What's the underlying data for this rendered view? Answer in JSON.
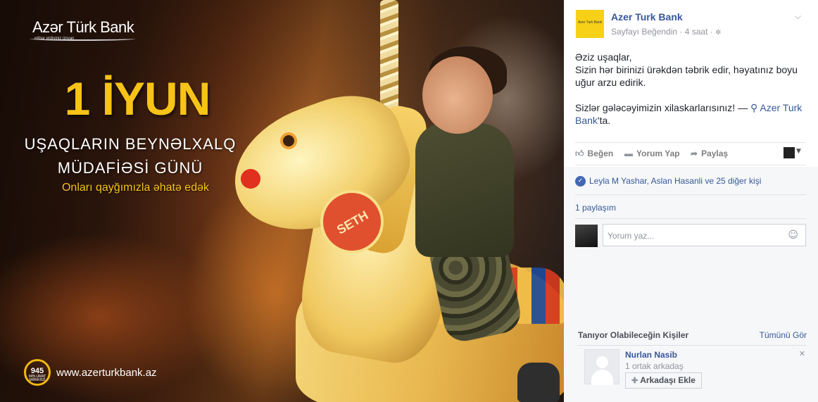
{
  "image": {
    "logo": {
      "name": "Azər Türk Bank",
      "slogan": "etibar etdiyiniz ünvan"
    },
    "headline": "1 İYUN",
    "subtitle_line1": "UŞAQLARIN BEYNƏLXALQ",
    "subtitle_line2": "MÜDAFİƏSİ GÜNÜ",
    "tagline": "Onları qayğımızla əhatə edək",
    "horse_tag": "SETH",
    "badge": {
      "number": "945",
      "text": "MƏLUMAT MƏRKƏZİ"
    },
    "website": "www.azerturkbank.az"
  },
  "post": {
    "page_avatar_text": "Azer Turk Bank",
    "page_name": "Azer Turk Bank",
    "meta": "Sayfayı Beğendin · 4 saat ·",
    "text_line1": "Əziz uşaqlar,",
    "text_line2": "Sizin hər birinizi ürəkdən təbrik edir, həyatınız boyu uğur arzu edirik.",
    "text_line3": "Sizlər gələcəyimizin xilaskarlarısınız! —",
    "location": "Azer Turk Bank",
    "location_suffix": "'ta."
  },
  "actions": {
    "like": "Beğen",
    "comment": "Yorum Yap",
    "share": "Paylaş"
  },
  "social": {
    "likes_text": "Leyla M Yashar, Aslan Hasanli ve 25 diğer kişi",
    "shares_text": "1 paylaşım",
    "comment_placeholder": "Yorum yaz..."
  },
  "pymk": {
    "title": "Tanıyor Olabileceğin Kişiler",
    "see_all": "Tümünü Gör",
    "person": {
      "name": "Nurlan Nasib",
      "mutual": "1 ortak arkadaş",
      "add_label": "Arkadaşı Ekle"
    }
  },
  "colors": {
    "link": "#365899",
    "accent_yellow": "#f7c317",
    "page_avatar_bg": "#f7d117"
  }
}
